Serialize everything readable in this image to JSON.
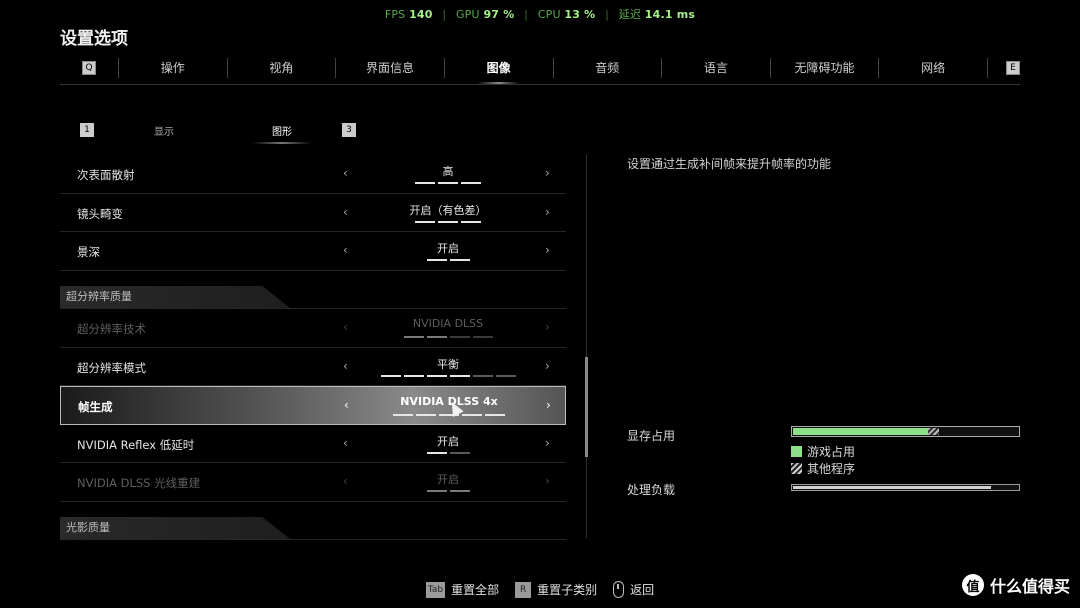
{
  "perf": {
    "fps_label": "FPS",
    "fps_value": "140",
    "gpu_label": "GPU",
    "gpu_value": "97 %",
    "cpu_label": "CPU",
    "cpu_value": "13 %",
    "latency_label": "延迟",
    "latency_value": "14.1 ms",
    "separator": "|"
  },
  "page_title": "设置选项",
  "tabs": {
    "key_left": "Q",
    "key_right": "E",
    "items": [
      {
        "label": "操作"
      },
      {
        "label": "视角"
      },
      {
        "label": "界面信息"
      },
      {
        "label": "图像",
        "active": true
      },
      {
        "label": "音频"
      },
      {
        "label": "语言"
      },
      {
        "label": "无障碍功能"
      },
      {
        "label": "网络"
      }
    ]
  },
  "subtabs": {
    "key_left": "1",
    "key_right": "3",
    "items": [
      {
        "label": "显示"
      },
      {
        "label": "图形",
        "active": true
      }
    ]
  },
  "settings": {
    "rows": [
      {
        "name": "次表面散射",
        "value": "高",
        "pips": 3,
        "level": 3
      },
      {
        "name": "镜头畸变",
        "value": "开启（有色差）",
        "pips": 3,
        "level": 3
      },
      {
        "name": "景深",
        "value": "开启",
        "pips": 2,
        "level": 2
      },
      {
        "section": "超分辨率质量"
      },
      {
        "name": "超分辨率技术",
        "value": "NVIDIA DLSS",
        "pips": 4,
        "level": 2,
        "disabled": true
      },
      {
        "name": "超分辨率模式",
        "value": "平衡",
        "pips": 6,
        "level": 4
      },
      {
        "name": "帧生成",
        "value": "NVIDIA DLSS 4x",
        "pips": 5,
        "level": 5,
        "selected": true
      },
      {
        "name": "NVIDIA Reflex 低延时",
        "value": "开启",
        "pips": 2,
        "level": 1
      },
      {
        "name": "NVIDIA DLSS 光线重建",
        "value": "开启",
        "pips": 2,
        "level": 2,
        "disabled": true
      },
      {
        "section": "光影质量"
      }
    ],
    "arrow_left": "‹",
    "arrow_right": "›"
  },
  "right_panel": {
    "description": "设置通过生成补间帧来提升帧率的功能",
    "vram_label": "显存占用",
    "vram_game_fraction": 0.6,
    "vram_other_fraction": 0.05,
    "legend_game": "游戏占用",
    "legend_other": "其他程序",
    "load_label": "处理负载",
    "load_fraction": 0.88
  },
  "colors": {
    "accent_green": "#8fe08a",
    "perf_green": "#7ec86a"
  },
  "bottom_hints": [
    {
      "key": "Tab",
      "label": "重置全部"
    },
    {
      "key": "R",
      "label": "重置子类别"
    },
    {
      "icon": "mouse-icon",
      "label": "返回"
    }
  ],
  "watermark": {
    "logo_char": "值",
    "text": "什么值得买"
  }
}
